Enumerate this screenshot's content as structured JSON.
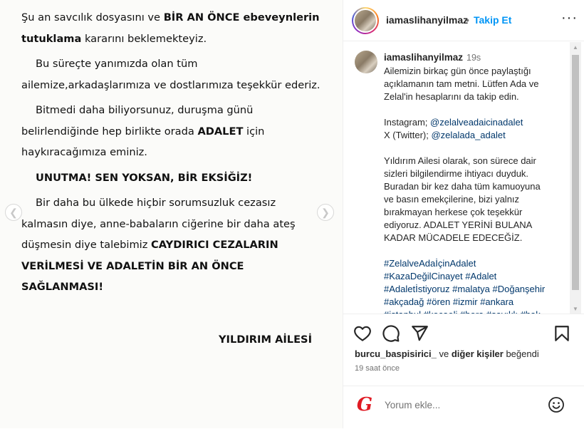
{
  "media": {
    "paragraphs": [
      {
        "parts": [
          {
            "t": "Şu an savcılık dosyasını ve ",
            "b": false
          },
          {
            "t": "BİR AN ÖNCE ebeveynlerin tutuklama",
            "b": true
          },
          {
            "t": " kararını beklemekteyiz.",
            "b": false
          }
        ]
      },
      {
        "parts": [
          {
            "t": "Bu süreçte yanımızda olan tüm ailemize,arkadaşlarımıza ve dostlarımıza teşekkür ederiz.",
            "b": false
          }
        ]
      },
      {
        "parts": [
          {
            "t": "Bitmedi daha biliyorsunuz, duruşma günü belirlendiğinde hep birlikte orada ",
            "b": false
          },
          {
            "t": "ADALET",
            "b": true
          },
          {
            "t": " için haykıracağımıza eminiz.",
            "b": false
          }
        ]
      },
      {
        "parts": [
          {
            "t": "UNUTMA! SEN YOKSAN, BİR EKSİĞİZ!",
            "b": true
          }
        ]
      },
      {
        "parts": [
          {
            "t": "Bir daha bu ülkede hiçbir sorumsuzluk cezasız kalmasın diye, anne-babaların ciğerine bir daha ateş düşmesin diye talebimiz ",
            "b": false
          },
          {
            "t": "CAYDIRICI CEZALARIN VERİLMESİ VE ADALETİN BİR AN ÖNCE SAĞLANMASI!",
            "b": true
          }
        ]
      }
    ],
    "signature": "YILDIRIM AİLESİ"
  },
  "header": {
    "username": "iamaslihanyilmaz",
    "separator": "•",
    "follow_label": "Takip Et",
    "more_label": "···"
  },
  "caption": {
    "username": "iamaslihanyilmaz",
    "time": "19s",
    "lines": [
      {
        "t": "Ailemizin birkaç gün önce paylaştığı",
        "link": false
      },
      {
        "t": "açıklamanın tam metni. Lütfen Ada ve",
        "link": false
      },
      {
        "t": "Zelal'in hesaplarını da takip edin.",
        "link": false
      },
      {
        "t": "",
        "link": false
      },
      {
        "segments": [
          {
            "t": "Instagram; ",
            "link": false
          },
          {
            "t": "@zelalveadaicinadalet",
            "link": true
          }
        ]
      },
      {
        "segments": [
          {
            "t": "X (Twitter); ",
            "link": false
          },
          {
            "t": "@zelalada_adalet",
            "link": true
          }
        ]
      },
      {
        "t": "",
        "link": false
      },
      {
        "t": "Yıldırım Ailesi olarak, son sürece dair",
        "link": false
      },
      {
        "t": "sizleri bilgilendirme ihtiyacı duyduk.",
        "link": false
      },
      {
        "t": "Buradan bir kez daha tüm kamuoyuna",
        "link": false
      },
      {
        "t": "ve basın emekçilerine, bizi yalnız",
        "link": false
      },
      {
        "t": "bırakmayan herkese çok teşekkür",
        "link": false
      },
      {
        "t": "ediyoruz. ADALET YERİNİ BULANA",
        "link": false
      },
      {
        "t": "KADAR MÜCADELE EDECEĞİZ.",
        "link": false
      },
      {
        "t": "",
        "link": false
      },
      {
        "segments": [
          {
            "t": "#ZelalveAdaİçinAdalet",
            "link": true
          }
        ]
      },
      {
        "segments": [
          {
            "t": "#KazaDeğilCinayet",
            "link": true
          },
          {
            "t": " ",
            "link": false
          },
          {
            "t": "#Adalet",
            "link": true
          }
        ]
      },
      {
        "segments": [
          {
            "t": "#Adaletİstiyoruz",
            "link": true
          },
          {
            "t": " ",
            "link": false
          },
          {
            "t": "#malatya",
            "link": true
          },
          {
            "t": " ",
            "link": false
          },
          {
            "t": "#Doğanşehir",
            "link": true
          }
        ]
      },
      {
        "segments": [
          {
            "t": "#akçadağ",
            "link": true
          },
          {
            "t": " ",
            "link": false
          },
          {
            "t": "#ören",
            "link": true
          },
          {
            "t": " ",
            "link": false
          },
          {
            "t": "#izmir",
            "link": true
          },
          {
            "t": " ",
            "link": false
          },
          {
            "t": "#ankara",
            "link": true
          }
        ]
      },
      {
        "segments": [
          {
            "t": "#istanbul",
            "link": true
          },
          {
            "t": " ",
            "link": false
          },
          {
            "t": "#kocaeli",
            "link": true
          },
          {
            "t": " ",
            "link": false
          },
          {
            "t": "#bora",
            "link": true
          },
          {
            "t": " ",
            "link": false
          },
          {
            "t": "#sayıklı",
            "link": true
          },
          {
            "t": " ",
            "link": false
          },
          {
            "t": "#hak",
            "link": true
          }
        ]
      }
    ]
  },
  "engagement": {
    "liker": "burcu_baspisirici_",
    "connector": " ve ",
    "others": "diğer kişiler",
    "suffix": " beğendi",
    "posted_ago": "19 saat önce"
  },
  "comment": {
    "placeholder": "Yorum ekle...",
    "logo_letter": "G"
  },
  "colors": {
    "link": "#00376b",
    "follow": "#0095f6",
    "logo_red": "#e01b24"
  }
}
